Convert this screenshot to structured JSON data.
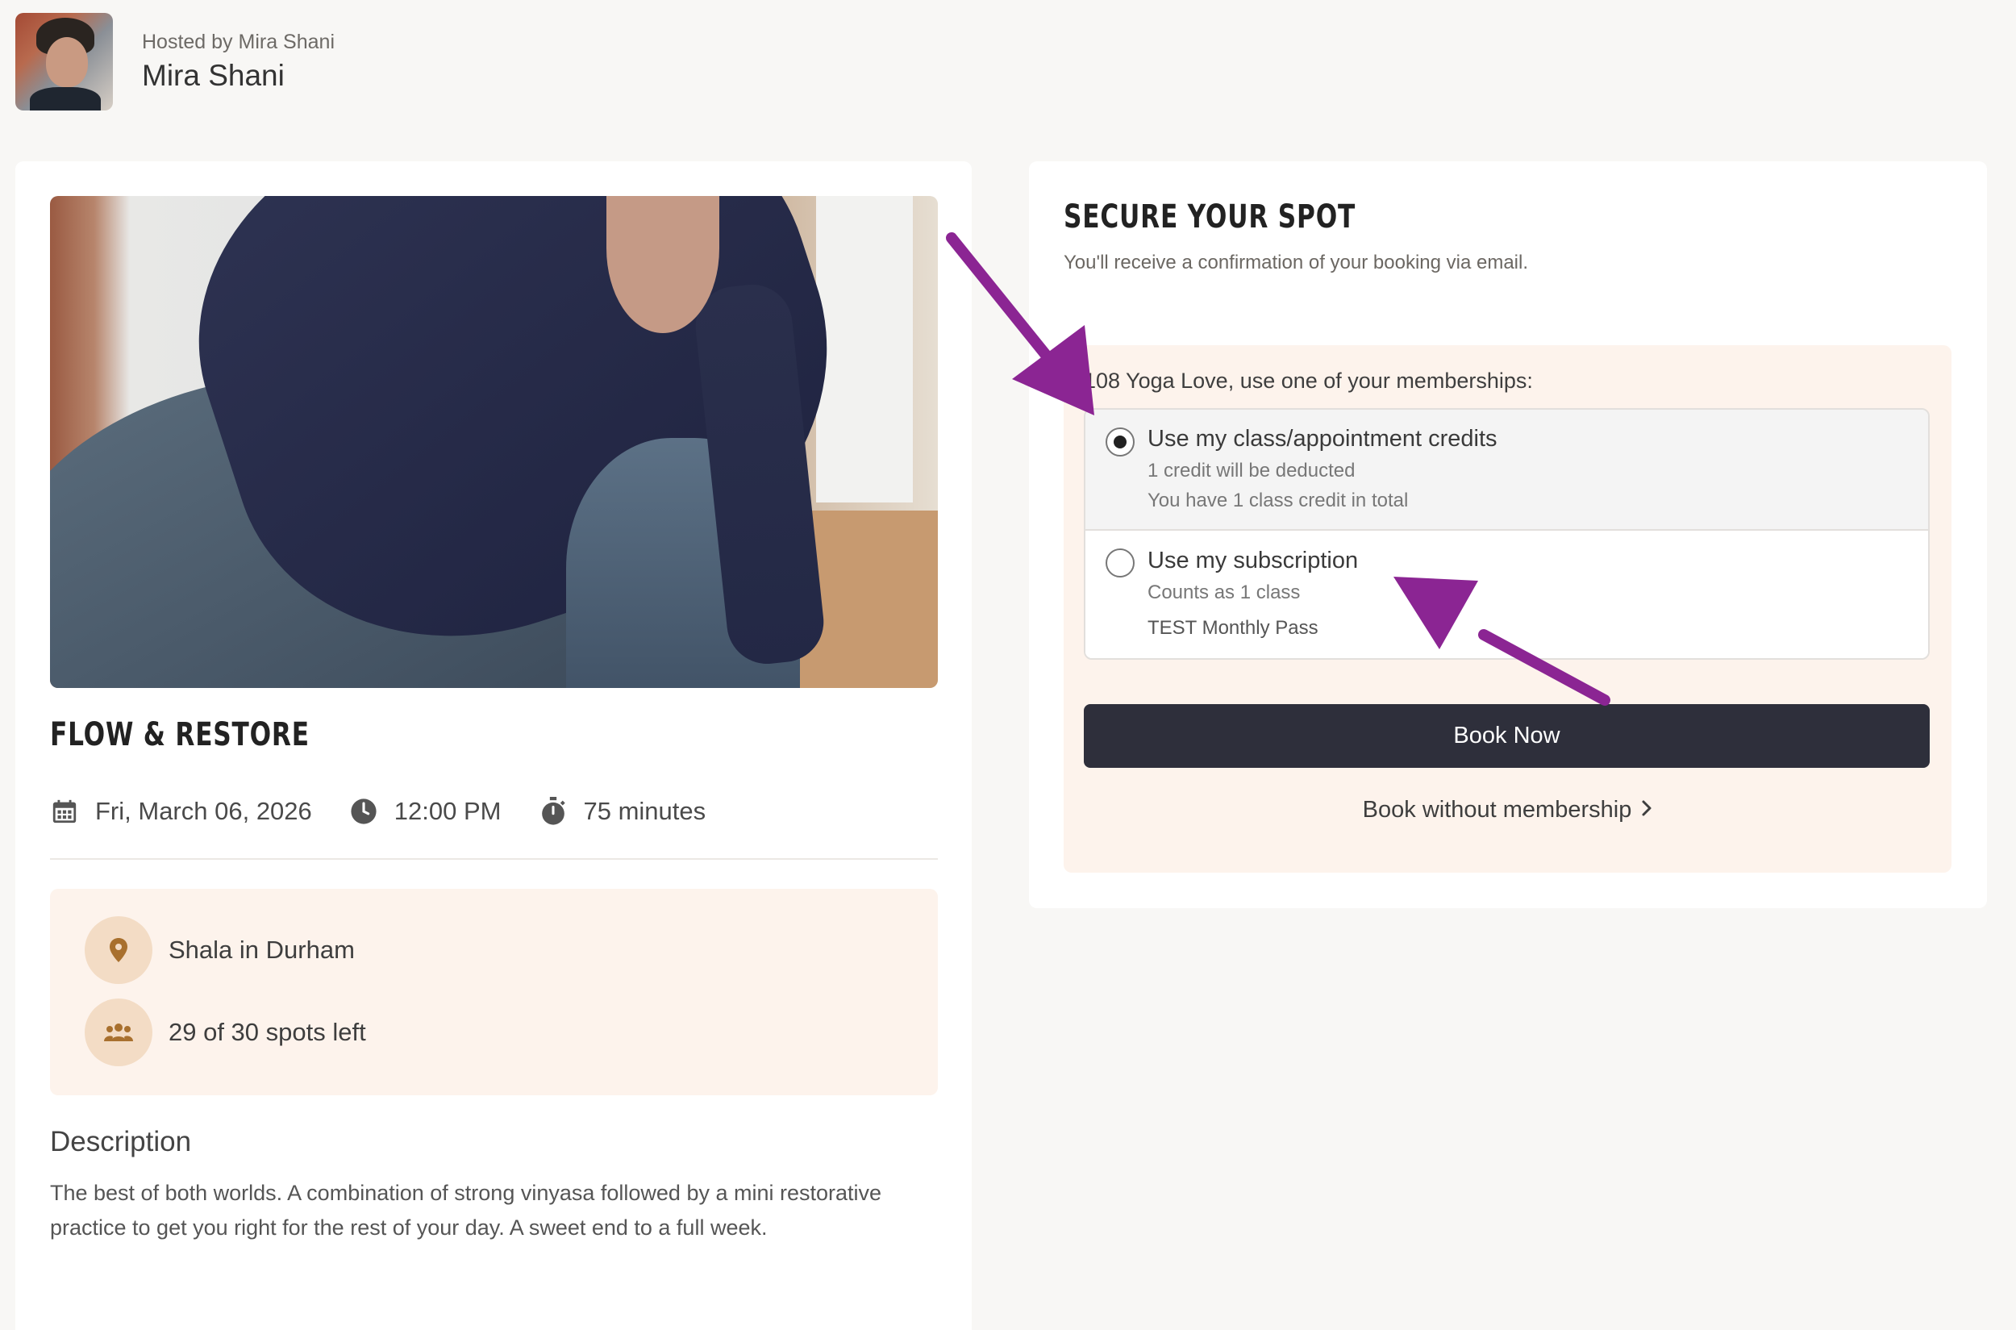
{
  "host": {
    "subtitle": "Hosted by Mira Shani",
    "name": "Mira Shani"
  },
  "class": {
    "title": "FLOW & RESTORE",
    "date": "Fri, March 06, 2026",
    "time": "12:00 PM",
    "duration": "75 minutes",
    "location": "Shala in Durham",
    "spots": "29 of 30 spots left",
    "description_title": "Description",
    "description": "The best of both worlds. A combination of strong vinyasa followed by a mini restorative practice to get you right for the rest of your day. A sweet end to a full week."
  },
  "booking": {
    "title": "SECURE YOUR SPOT",
    "subtitle": "You'll receive a confirmation of your booking via email.",
    "membership_label": "108 Yoga Love, use one of your memberships:",
    "options": [
      {
        "title": "Use my class/appointment credits",
        "line1": "1 credit will be deducted",
        "line2": "You have 1 class credit in total",
        "selected": true
      },
      {
        "title": "Use my subscription",
        "line1": "Counts as 1 class",
        "line2": "TEST Monthly Pass",
        "selected": false
      }
    ],
    "book_button": "Book Now",
    "no_membership_link": "Book without membership"
  },
  "icons": {
    "calendar": "calendar-icon",
    "clock": "clock-icon",
    "timer": "stopwatch-icon",
    "location": "map-pin-icon",
    "people": "users-icon",
    "chevron": "chevron-right-icon"
  },
  "colors": {
    "accent_bg": "#fdf3ec",
    "badge_bg": "#f3dcc5",
    "badge_icon": "#a8702e",
    "button_bg": "#2e2f3b",
    "arrow": "#8b2593"
  }
}
